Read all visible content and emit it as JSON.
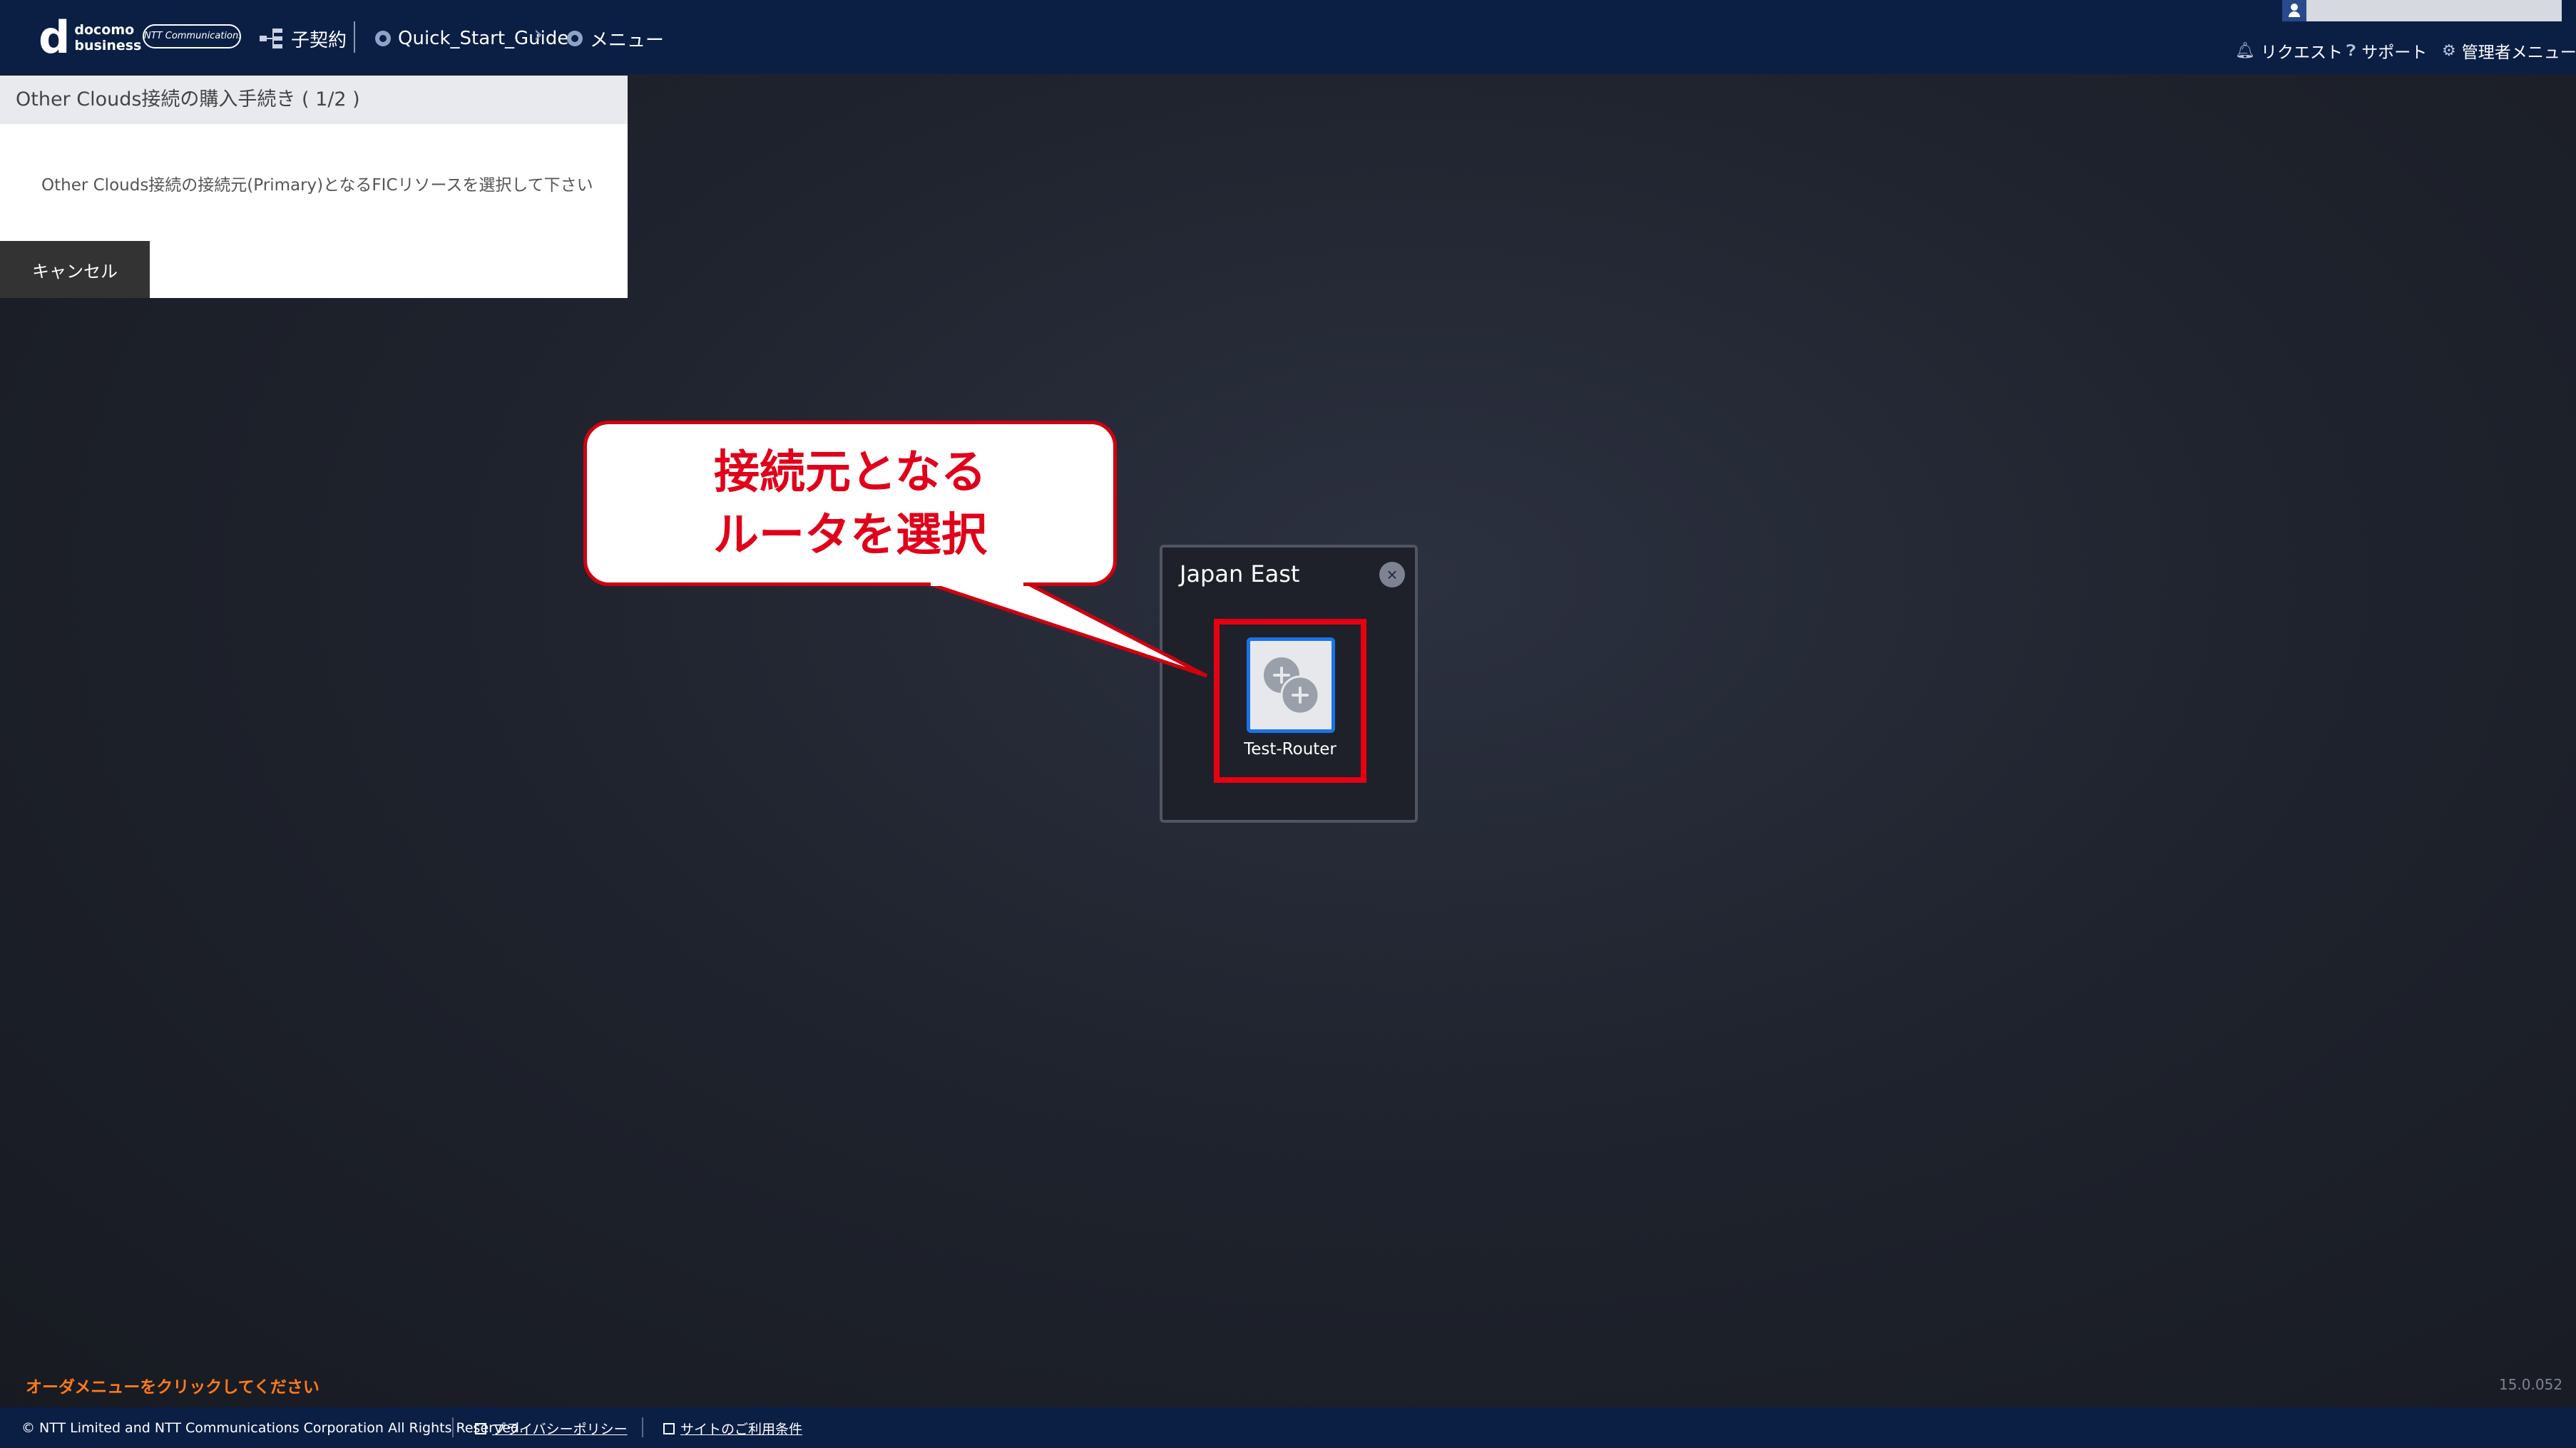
{
  "header": {
    "logo_d": "d",
    "logo_top": "docomo",
    "logo_bottom": "business",
    "ntt_logo": "NTT Communications",
    "breadcrumb": [
      {
        "label": "子契約",
        "icon": "tree-icon"
      },
      {
        "label": "Quick_Start_Guide",
        "icon": "globe-icon"
      },
      {
        "label": "メニュー",
        "icon": "globe-icon"
      }
    ],
    "user_icon": "user-icon",
    "links": [
      {
        "label": "リクエスト",
        "icon": "bell-icon"
      },
      {
        "label": "サポート",
        "icon": "question-icon"
      },
      {
        "label": "管理者メニュー",
        "icon": "gear-icon"
      }
    ]
  },
  "panel": {
    "title": "Other Clouds接続の購入手続き ( 1/2 )",
    "message": "Other Clouds接続の接続元(Primary)となるFICリソースを選択して下さい",
    "cancel_label": "キャンセル"
  },
  "callout": {
    "line1": "接続元となる",
    "line2": "ルータを選択"
  },
  "region": {
    "title": "Japan East",
    "close_icon": "close-icon",
    "router_label": "Test-Router",
    "router_icon": "router-icon"
  },
  "order_hint": "オーダメニューをクリックしてください",
  "version": "15.0.052",
  "footer": {
    "copyright": "© NTT Limited and NTT Communications Corporation All Rights Reserved.",
    "privacy": "プライバシーポリシー",
    "terms": "サイトのご利用条件"
  },
  "colors": {
    "header_bg": "#0b1f45",
    "highlight_red": "#e60012",
    "callout_text": "#e0001a",
    "router_blue": "#1a73e8",
    "hint_orange": "#ff7a1a"
  }
}
